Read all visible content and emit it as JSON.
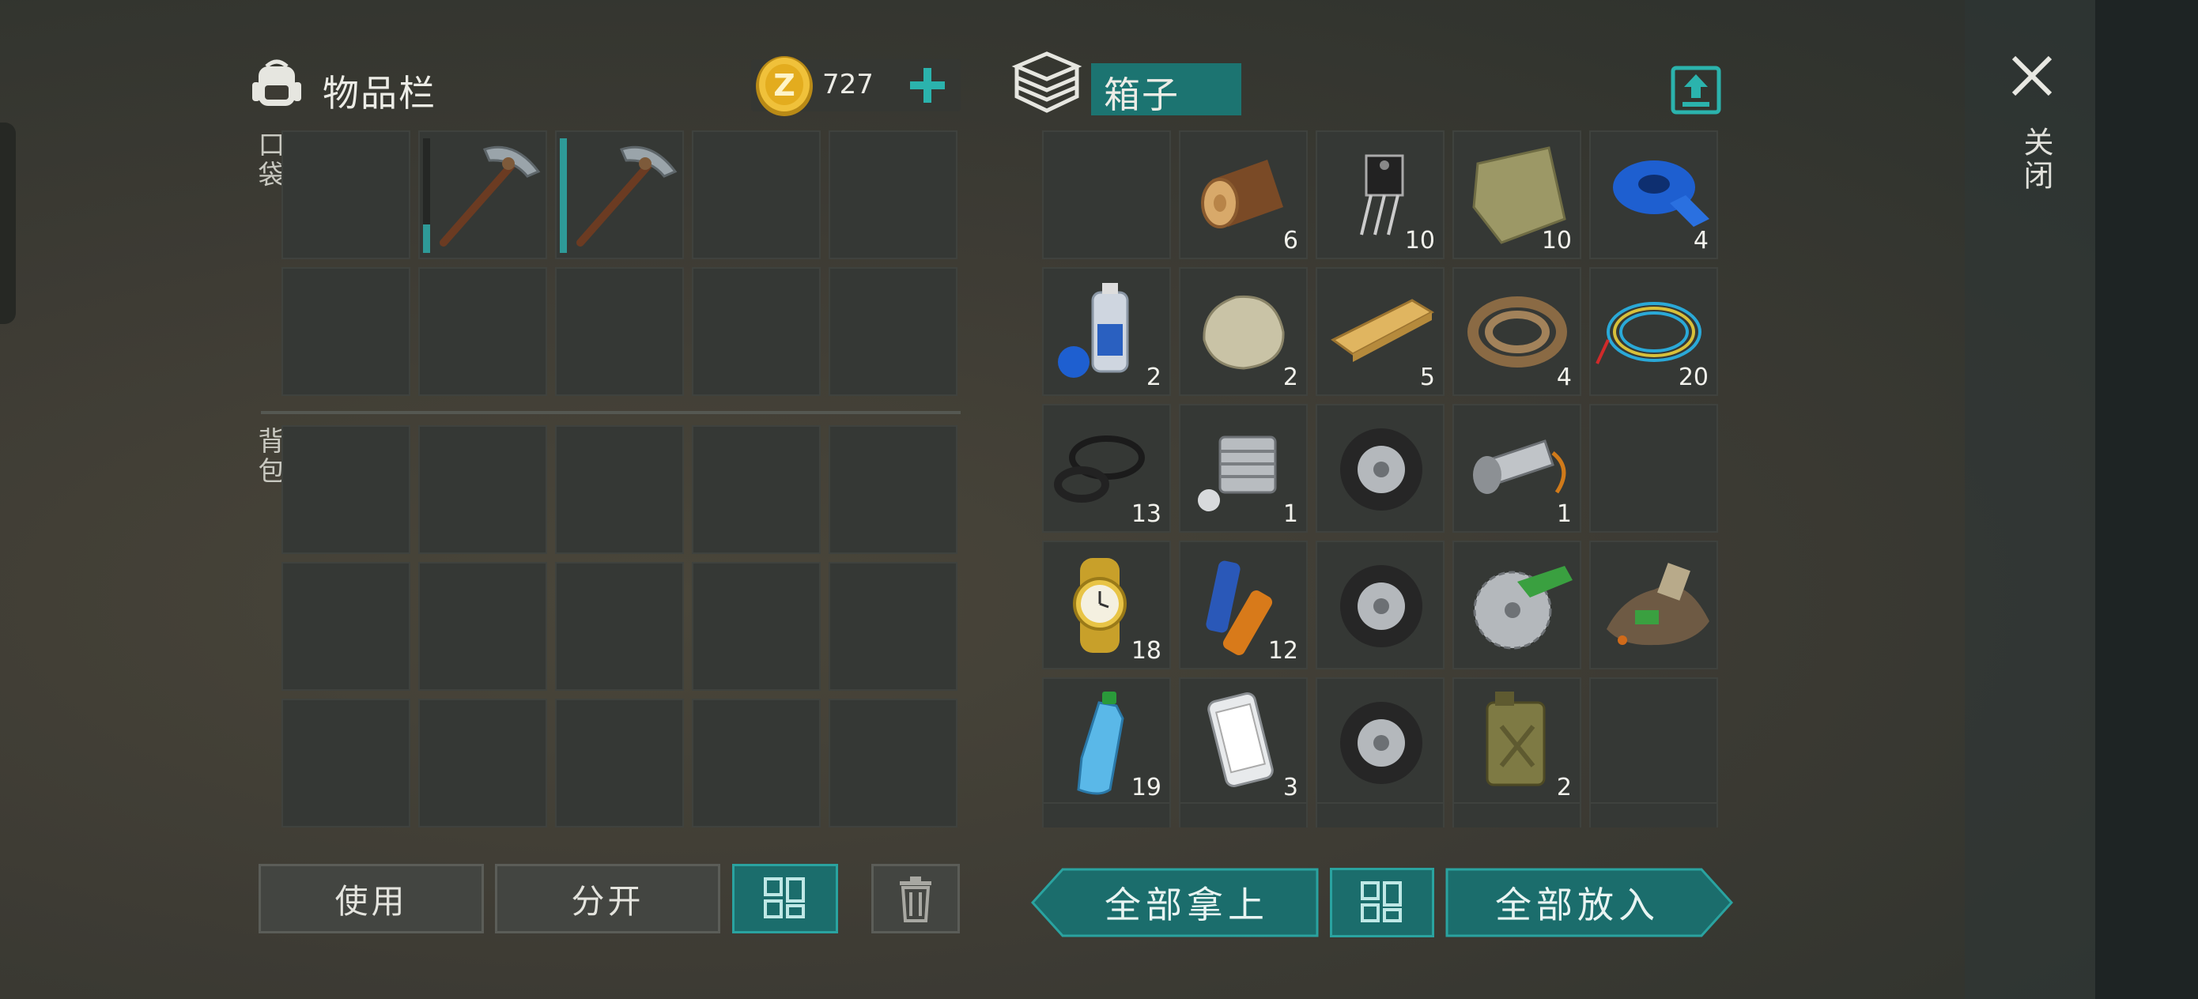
{
  "inventory": {
    "title": "物品栏",
    "coins": "727",
    "pocket_label": "口袋",
    "backpack_label": "背包",
    "pocket_items": [
      {
        "icon": "empty"
      },
      {
        "icon": "pickaxe-icon",
        "durability": 0.25
      },
      {
        "icon": "pickaxe-icon",
        "durability": 1.0
      },
      {
        "icon": "empty"
      },
      {
        "icon": "empty"
      },
      {
        "icon": "empty"
      },
      {
        "icon": "empty"
      },
      {
        "icon": "empty"
      },
      {
        "icon": "empty"
      },
      {
        "icon": "empty"
      }
    ],
    "buttons": {
      "use": "使用",
      "split": "分开"
    }
  },
  "box": {
    "title": "箱子",
    "items": [
      {
        "icon": "empty",
        "qty": ""
      },
      {
        "icon": "log-icon",
        "qty": "6"
      },
      {
        "icon": "transistor-icon",
        "qty": "10"
      },
      {
        "icon": "cloth-icon",
        "qty": "10"
      },
      {
        "icon": "tape-icon",
        "qty": "4"
      },
      {
        "icon": "paint-icon",
        "qty": "2"
      },
      {
        "icon": "stone-icon",
        "qty": "2"
      },
      {
        "icon": "plank-icon",
        "qty": "5"
      },
      {
        "icon": "rope-icon",
        "qty": "4"
      },
      {
        "icon": "wire-icon",
        "qty": "20"
      },
      {
        "icon": "rubber-rings-icon",
        "qty": "13"
      },
      {
        "icon": "engine-cylinder-icon",
        "qty": "1"
      },
      {
        "icon": "tire-icon",
        "qty": ""
      },
      {
        "icon": "flashlight-icon",
        "qty": "1"
      },
      {
        "icon": "empty",
        "qty": ""
      },
      {
        "icon": "watch-icon",
        "qty": "18"
      },
      {
        "icon": "batteries-icon",
        "qty": "12"
      },
      {
        "icon": "tire-icon",
        "qty": ""
      },
      {
        "icon": "saw-blade-icon",
        "qty": ""
      },
      {
        "icon": "scrap-pile-icon",
        "qty": ""
      },
      {
        "icon": "water-bottle-icon",
        "qty": "19"
      },
      {
        "icon": "phone-icon",
        "qty": "3"
      },
      {
        "icon": "tire-icon",
        "qty": ""
      },
      {
        "icon": "jerrycan-icon",
        "qty": "2"
      },
      {
        "icon": "empty",
        "qty": ""
      }
    ],
    "buttons": {
      "take_all": "全部拿上",
      "put_all": "全部放入"
    }
  },
  "close_label": "关闭",
  "colors": {
    "accent": "#1b6d6c",
    "accent_border": "#2aa3a0",
    "cell": "#353835"
  }
}
